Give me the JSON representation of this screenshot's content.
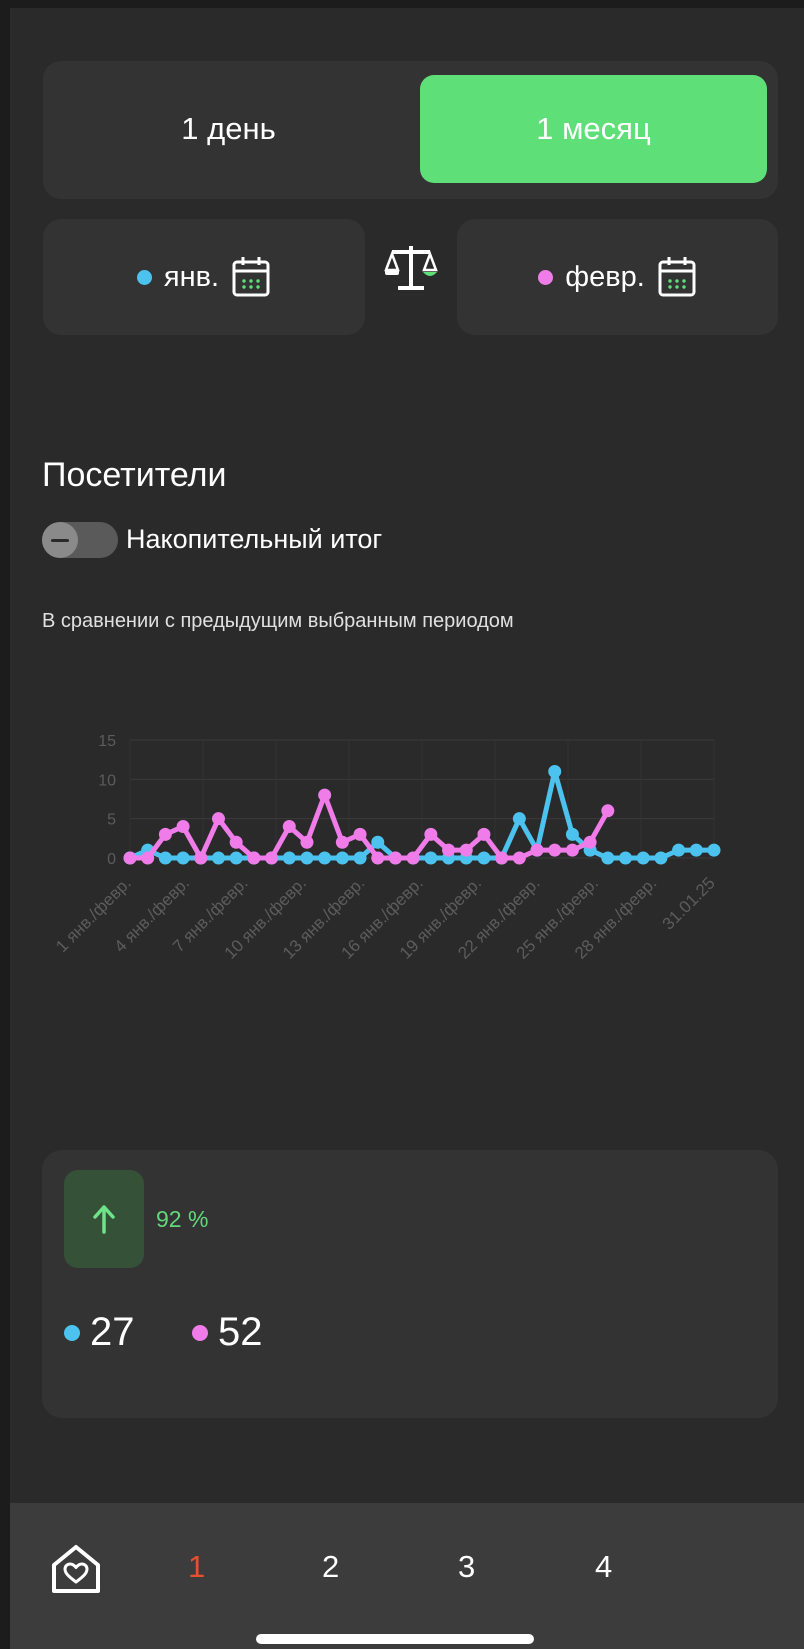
{
  "colors": {
    "accent": "#5fdf78",
    "series_a": "#4cc3ee",
    "series_b": "#ef7ce9",
    "nav_active": "#e4512f"
  },
  "period_toggle": {
    "day_label": "1 день",
    "month_label": "1 месяц",
    "selected": "1 месяц"
  },
  "compare": {
    "period_a_label": "янв.",
    "period_b_label": "февр.",
    "calendar_icon": "calendar-icon",
    "compare_icon": "scale-icon"
  },
  "section": {
    "title": "Посетители",
    "cumulative_toggle_label": "Накопительный итог",
    "cumulative_toggle_on": false,
    "subtitle": "В сравнении с предыдущим выбранным периодом"
  },
  "chart_data": {
    "type": "line",
    "x_tick_labels": [
      "1 янв./февр.",
      "4 янв./февр.",
      "7 янв./февр.",
      "10 янв./февр.",
      "13 янв./февр.",
      "16 янв./февр.",
      "19 янв./февр.",
      "22 янв./февр.",
      "25 янв./февр.",
      "28 янв./февр.",
      "31.01.25"
    ],
    "y_ticks": [
      0,
      5,
      10,
      15
    ],
    "ylim": [
      0,
      15
    ],
    "x": [
      1,
      2,
      3,
      4,
      5,
      6,
      7,
      8,
      9,
      10,
      11,
      12,
      13,
      14,
      15,
      16,
      17,
      18,
      19,
      20,
      21,
      22,
      23,
      24,
      25,
      26,
      27,
      28,
      29,
      30,
      31
    ],
    "series": [
      {
        "values": [
          0,
          1,
          0,
          0,
          0,
          0,
          0,
          0,
          0,
          0,
          0,
          0,
          0,
          0,
          2,
          0,
          0,
          0,
          0,
          0,
          0,
          0,
          5,
          1,
          11,
          3,
          1,
          0,
          0,
          0,
          0,
          1,
          1,
          1
        ]
      },
      {
        "values": [
          0,
          0,
          3,
          4,
          0,
          5,
          2,
          0,
          0,
          4,
          2,
          8,
          2,
          3,
          0,
          0,
          0,
          3,
          1,
          1,
          3,
          0,
          0,
          1,
          1,
          1,
          2,
          6
        ]
      }
    ],
    "grid": true
  },
  "summary": {
    "change_icon": "arrow-up-icon",
    "change_text": "92 %",
    "value_a": "27",
    "value_b": "52"
  },
  "nav": {
    "home_icon": "home-heart-icon",
    "items": [
      "1",
      "2",
      "3",
      "4"
    ],
    "active": "1"
  }
}
